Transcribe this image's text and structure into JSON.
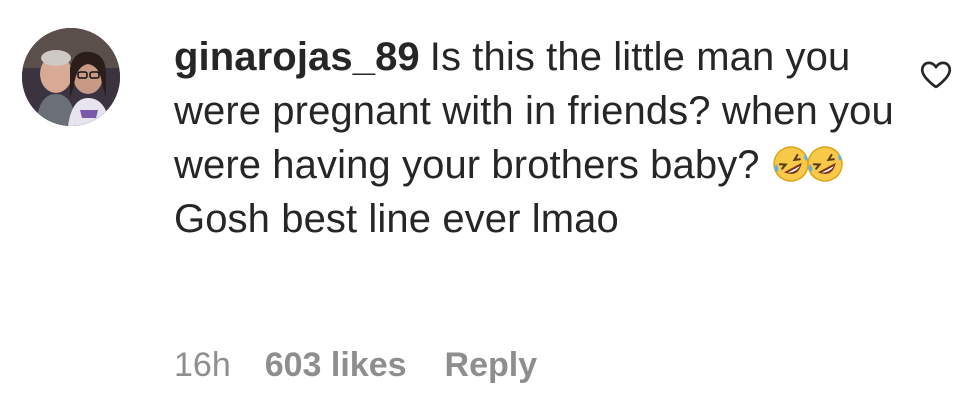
{
  "comment": {
    "avatar_icon": "profile-photo",
    "username": "ginarojas_89",
    "text_before_emoji": "Is this the little man you were pregnant with in friends? when you were having your brothers baby?",
    "emoji": [
      "rolling-on-floor-laughing-emoji",
      "rolling-on-floor-laughing-emoji"
    ],
    "text_after_emoji": "Gosh best line ever lmao",
    "like_icon": "heart-outline-icon",
    "timestamp": "16h",
    "likes": "603 likes",
    "reply_label": "Reply"
  },
  "colors": {
    "text": "#262626",
    "meta": "#8e8e8e",
    "emoji": "#f7c948"
  }
}
